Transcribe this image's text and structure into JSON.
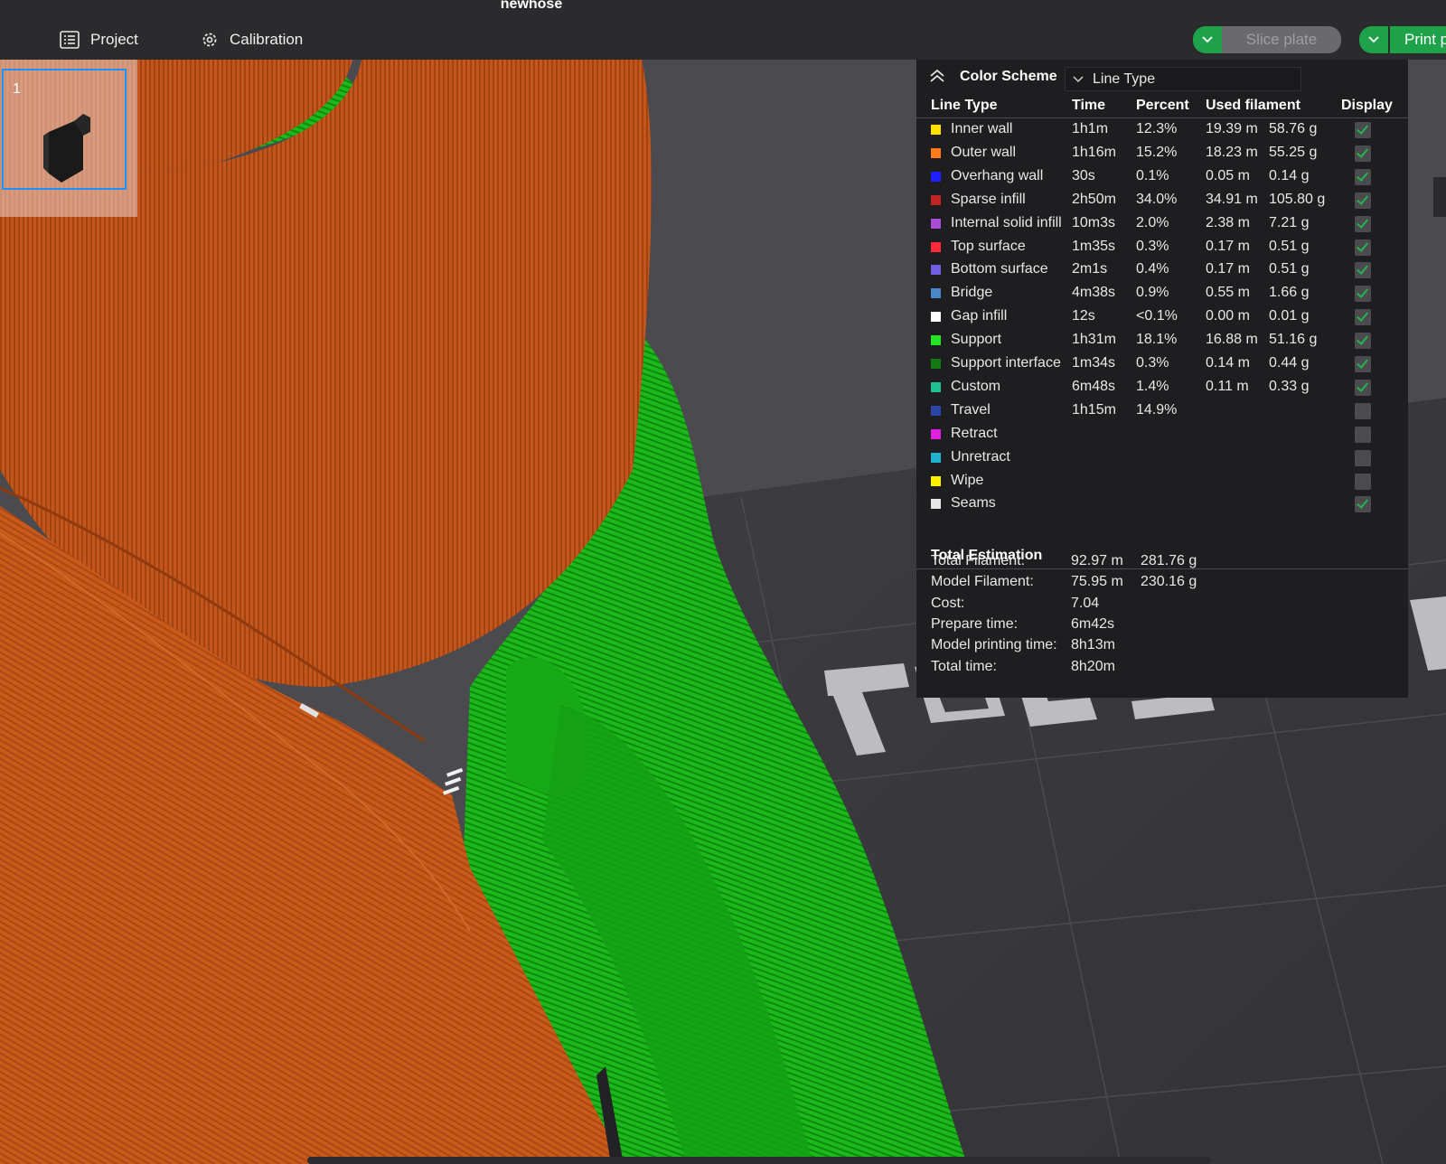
{
  "window": {
    "title": "newhose"
  },
  "topbar": {
    "project_label": "Project",
    "calibration_label": "Calibration",
    "slice_label": "Slice plate",
    "print_label": "Print p"
  },
  "plate": {
    "number": "1"
  },
  "legend": {
    "title": "Color Scheme",
    "scheme_value": "Line Type",
    "columns": [
      "Line Type",
      "Time",
      "Percent",
      "Used filament",
      "Display"
    ],
    "rows": [
      {
        "name": "Inner wall",
        "color": "#FFE000",
        "time": "1h1m",
        "percent": "12.3%",
        "length": "19.39 m",
        "weight": "58.76 g",
        "display": true
      },
      {
        "name": "Outer wall",
        "color": "#FF7A1A",
        "time": "1h16m",
        "percent": "15.2%",
        "length": "18.23 m",
        "weight": "55.25 g",
        "display": true
      },
      {
        "name": "Overhang wall",
        "color": "#1F1FFF",
        "time": "30s",
        "percent": "0.1%",
        "length": "0.05 m",
        "weight": "0.14 g",
        "display": true
      },
      {
        "name": "Sparse infill",
        "color": "#C02424",
        "time": "2h50m",
        "percent": "34.0%",
        "length": "34.91 m",
        "weight": "105.80 g",
        "display": true
      },
      {
        "name": "Internal solid infill",
        "color": "#A84BD6",
        "time": "10m3s",
        "percent": "2.0%",
        "length": "2.38 m",
        "weight": "7.21 g",
        "display": true
      },
      {
        "name": "Top surface",
        "color": "#FF2A3A",
        "time": "1m35s",
        "percent": "0.3%",
        "length": "0.17 m",
        "weight": "0.51 g",
        "display": true
      },
      {
        "name": "Bottom surface",
        "color": "#7060E0",
        "time": "2m1s",
        "percent": "0.4%",
        "length": "0.17 m",
        "weight": "0.51 g",
        "display": true
      },
      {
        "name": "Bridge",
        "color": "#4A86C8",
        "time": "4m38s",
        "percent": "0.9%",
        "length": "0.55 m",
        "weight": "1.66 g",
        "display": true
      },
      {
        "name": "Gap infill",
        "color": "#FFFFFF",
        "time": "12s",
        "percent": "<0.1%",
        "length": "0.00 m",
        "weight": "0.01 g",
        "display": true
      },
      {
        "name": "Support",
        "color": "#22E622",
        "time": "1h31m",
        "percent": "18.1%",
        "length": "16.88 m",
        "weight": "51.16 g",
        "display": true
      },
      {
        "name": "Support interface",
        "color": "#127A12",
        "time": "1m34s",
        "percent": "0.3%",
        "length": "0.14 m",
        "weight": "0.44 g",
        "display": true
      },
      {
        "name": "Custom",
        "color": "#20C090",
        "time": "6m48s",
        "percent": "1.4%",
        "length": "0.11 m",
        "weight": "0.33 g",
        "display": true
      },
      {
        "name": "Travel",
        "color": "#2B45A8",
        "time": "1h15m",
        "percent": "14.9%",
        "length": "",
        "weight": "",
        "display": false
      },
      {
        "name": "Retract",
        "color": "#E020E0",
        "time": "",
        "percent": "",
        "length": "",
        "weight": "",
        "display": false
      },
      {
        "name": "Unretract",
        "color": "#20B0D0",
        "time": "",
        "percent": "",
        "length": "",
        "weight": "",
        "display": false
      },
      {
        "name": "Wipe",
        "color": "#FFF000",
        "time": "",
        "percent": "",
        "length": "",
        "weight": "",
        "display": false
      },
      {
        "name": "Seams",
        "color": "#E6E6E6",
        "time": "",
        "percent": "",
        "length": "",
        "weight": "",
        "display": true
      }
    ],
    "total_title": "Total Estimation",
    "totals": [
      {
        "label": "Total Filament:",
        "v1": "92.97 m",
        "v2": "281.76 g"
      },
      {
        "label": "Model Filament:",
        "v1": "75.95 m",
        "v2": "230.16 g"
      },
      {
        "label": "Cost:",
        "v1": "7.04",
        "v2": ""
      },
      {
        "label": "Prepare time:",
        "v1": "6m42s",
        "v2": ""
      },
      {
        "label": "Model printing time:",
        "v1": "8h13m",
        "v2": ""
      },
      {
        "label": "Total time:",
        "v1": "8h20m",
        "v2": ""
      }
    ]
  },
  "colors": {
    "accent_green": "#1FA34A",
    "outer_wall_orange": "#C85A1C",
    "support_green": "#18B418",
    "panel_bg": "#1E1E20"
  }
}
